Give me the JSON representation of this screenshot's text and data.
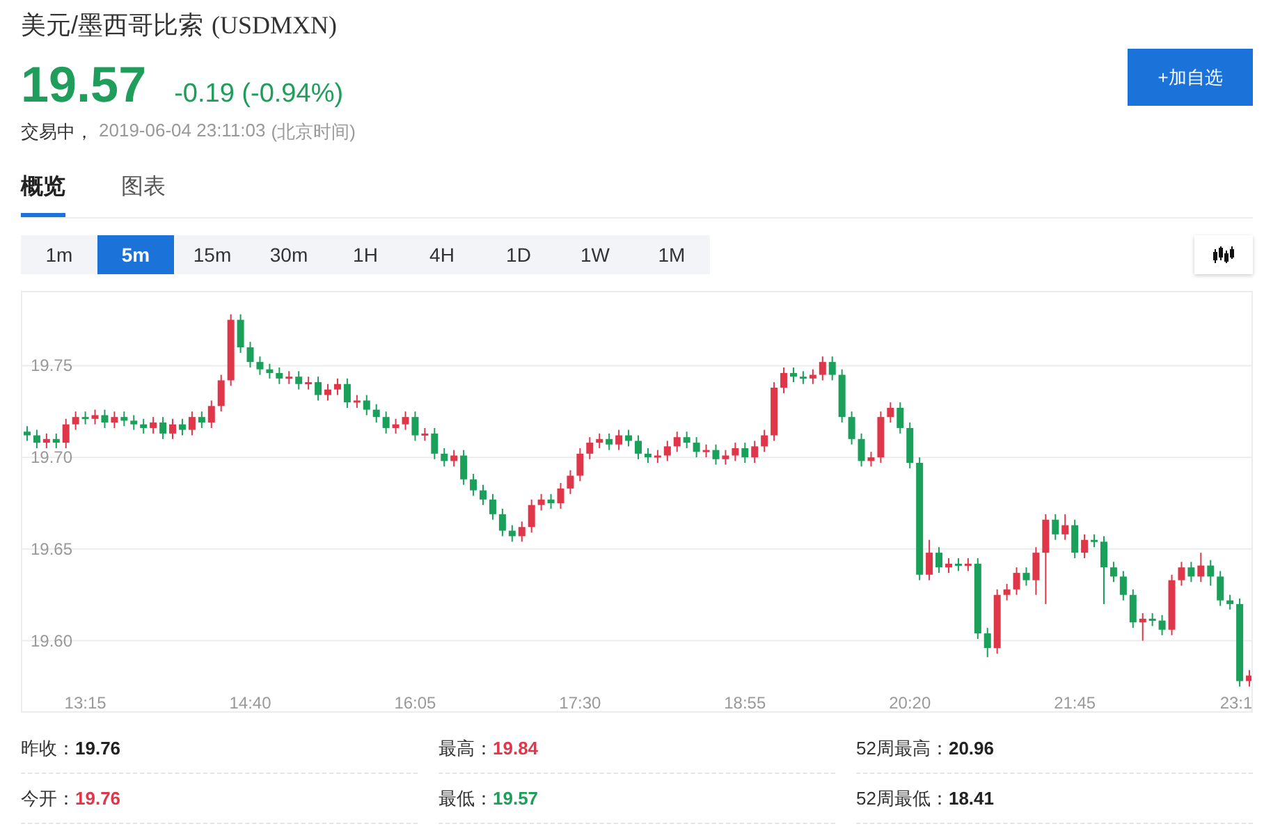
{
  "header": {
    "title": "美元/墨西哥比索",
    "code": "(USDMXN)",
    "price": "19.57",
    "change": "-0.19 (-0.94%)",
    "color": "#1e9e5a",
    "status": "交易中，",
    "time": "2019-06-04 23:11:03",
    "timezone": "(北京时间)",
    "watch_button": "+加自选"
  },
  "tabs": [
    {
      "label": "概览",
      "selected": true
    },
    {
      "label": "图表",
      "selected": false
    }
  ],
  "intervals": [
    {
      "label": "1m",
      "selected": false
    },
    {
      "label": "5m",
      "selected": true
    },
    {
      "label": "15m",
      "selected": false
    },
    {
      "label": "30m",
      "selected": false
    },
    {
      "label": "1H",
      "selected": false
    },
    {
      "label": "4H",
      "selected": false
    },
    {
      "label": "1D",
      "selected": false
    },
    {
      "label": "1W",
      "selected": false
    },
    {
      "label": "1M",
      "selected": false
    }
  ],
  "chart": {
    "chart_data": {
      "type": "candlestick",
      "categories": [
        null,
        null,
        null,
        null,
        null,
        null,
        "13:15",
        null,
        null,
        null,
        null,
        null,
        null,
        null,
        null,
        null,
        null,
        null,
        null,
        null,
        null,
        null,
        null,
        "14:40",
        null,
        null,
        null,
        null,
        null,
        null,
        null,
        null,
        null,
        null,
        null,
        null,
        null,
        null,
        null,
        null,
        "16:05",
        null,
        null,
        null,
        null,
        null,
        null,
        null,
        null,
        null,
        null,
        null,
        null,
        null,
        null,
        null,
        null,
        "17:30",
        null,
        null,
        null,
        null,
        null,
        null,
        null,
        null,
        null,
        null,
        null,
        null,
        null,
        null,
        null,
        null,
        "18:55",
        null,
        null,
        null,
        null,
        null,
        null,
        null,
        null,
        null,
        null,
        null,
        null,
        null,
        null,
        null,
        null,
        "20:20",
        null,
        null,
        null,
        null,
        null,
        null,
        null,
        null,
        null,
        null,
        null,
        null,
        null,
        null,
        null,
        null,
        "21:45",
        null,
        null,
        null,
        null,
        null,
        null,
        null,
        null,
        null,
        null,
        null,
        null,
        null,
        null,
        null,
        null,
        "23:1",
        null
      ],
      "ohlc": [
        [
          19.714,
          19.717,
          19.709,
          19.712
        ],
        [
          19.712,
          19.715,
          19.705,
          19.708
        ],
        [
          19.708,
          19.713,
          19.705,
          19.71
        ],
        [
          19.71,
          19.713,
          19.705,
          19.708
        ],
        [
          19.708,
          19.721,
          19.705,
          19.718
        ],
        [
          19.718,
          19.725,
          19.715,
          19.722
        ],
        [
          19.722,
          19.725,
          19.718,
          19.721
        ],
        [
          19.721,
          19.726,
          19.718,
          19.723
        ],
        [
          19.723,
          19.726,
          19.716,
          19.719
        ],
        [
          19.719,
          19.725,
          19.716,
          19.722
        ],
        [
          19.722,
          19.725,
          19.717,
          19.72
        ],
        [
          19.72,
          19.723,
          19.715,
          19.718
        ],
        [
          19.718,
          19.721,
          19.713,
          19.716
        ],
        [
          19.716,
          19.722,
          19.713,
          19.719
        ],
        [
          19.719,
          19.722,
          19.71,
          19.713
        ],
        [
          19.713,
          19.721,
          19.71,
          19.718
        ],
        [
          19.718,
          19.721,
          19.712,
          19.715
        ],
        [
          19.715,
          19.725,
          19.712,
          19.722
        ],
        [
          19.722,
          19.725,
          19.716,
          19.719
        ],
        [
          19.719,
          19.731,
          19.716,
          19.728
        ],
        [
          19.728,
          19.745,
          19.725,
          19.742
        ],
        [
          19.742,
          19.778,
          19.739,
          19.775
        ],
        [
          19.775,
          19.778,
          19.757,
          19.76
        ],
        [
          19.76,
          19.763,
          19.749,
          19.752
        ],
        [
          19.752,
          19.755,
          19.745,
          19.748
        ],
        [
          19.748,
          19.751,
          19.743,
          19.746
        ],
        [
          19.746,
          19.749,
          19.74,
          19.743
        ],
        [
          19.743,
          19.747,
          19.74,
          19.744
        ],
        [
          19.744,
          19.747,
          19.737,
          19.74
        ],
        [
          19.74,
          19.744,
          19.737,
          19.741
        ],
        [
          19.741,
          19.744,
          19.731,
          19.734
        ],
        [
          19.734,
          19.74,
          19.731,
          19.737
        ],
        [
          19.737,
          19.743,
          19.734,
          19.74
        ],
        [
          19.74,
          19.743,
          19.727,
          19.73
        ],
        [
          19.73,
          19.734,
          19.727,
          19.731
        ],
        [
          19.731,
          19.734,
          19.723,
          19.726
        ],
        [
          19.726,
          19.729,
          19.719,
          19.722
        ],
        [
          19.722,
          19.725,
          19.713,
          19.716
        ],
        [
          19.716,
          19.721,
          19.713,
          19.718
        ],
        [
          19.718,
          19.725,
          19.715,
          19.722
        ],
        [
          19.722,
          19.725,
          19.709,
          19.712
        ],
        [
          19.712,
          19.716,
          19.709,
          19.713
        ],
        [
          19.713,
          19.716,
          19.699,
          19.702
        ],
        [
          19.702,
          19.705,
          19.695,
          19.698
        ],
        [
          19.698,
          19.704,
          19.695,
          19.701
        ],
        [
          19.701,
          19.704,
          19.685,
          19.688
        ],
        [
          19.688,
          19.691,
          19.679,
          19.682
        ],
        [
          19.682,
          19.685,
          19.674,
          19.677
        ],
        [
          19.677,
          19.68,
          19.666,
          19.669
        ],
        [
          19.669,
          19.672,
          19.657,
          19.66
        ],
        [
          19.66,
          19.663,
          19.654,
          19.657
        ],
        [
          19.657,
          19.665,
          19.654,
          19.662
        ],
        [
          19.662,
          19.677,
          19.659,
          19.674
        ],
        [
          19.674,
          19.68,
          19.671,
          19.677
        ],
        [
          19.677,
          19.68,
          19.672,
          19.675
        ],
        [
          19.675,
          19.686,
          19.672,
          19.683
        ],
        [
          19.683,
          19.693,
          19.68,
          19.69
        ],
        [
          19.69,
          19.705,
          19.687,
          19.702
        ],
        [
          19.702,
          19.711,
          19.699,
          19.708
        ],
        [
          19.708,
          19.713,
          19.705,
          19.71
        ],
        [
          19.71,
          19.713,
          19.704,
          19.707
        ],
        [
          19.707,
          19.715,
          19.704,
          19.712
        ],
        [
          19.712,
          19.715,
          19.706,
          19.709
        ],
        [
          19.709,
          19.712,
          19.699,
          19.702
        ],
        [
          19.702,
          19.705,
          19.697,
          19.7
        ],
        [
          19.7,
          19.704,
          19.697,
          19.701
        ],
        [
          19.701,
          19.709,
          19.698,
          19.706
        ],
        [
          19.706,
          19.714,
          19.703,
          19.711
        ],
        [
          19.711,
          19.714,
          19.705,
          19.708
        ],
        [
          19.708,
          19.711,
          19.7,
          19.703
        ],
        [
          19.703,
          19.707,
          19.7,
          19.704
        ],
        [
          19.704,
          19.707,
          19.696,
          19.699
        ],
        [
          19.699,
          19.704,
          19.696,
          19.701
        ],
        [
          19.701,
          19.708,
          19.698,
          19.705
        ],
        [
          19.705,
          19.708,
          19.697,
          19.7
        ],
        [
          19.7,
          19.709,
          19.697,
          19.706
        ],
        [
          19.706,
          19.715,
          19.703,
          19.712
        ],
        [
          19.712,
          19.741,
          19.709,
          19.738
        ],
        [
          19.738,
          19.749,
          19.735,
          19.746
        ],
        [
          19.746,
          19.749,
          19.741,
          19.744
        ],
        [
          19.744,
          19.747,
          19.74,
          19.743
        ],
        [
          19.743,
          19.748,
          19.74,
          19.745
        ],
        [
          19.745,
          19.755,
          19.742,
          19.752
        ],
        [
          19.752,
          19.755,
          19.742,
          19.745
        ],
        [
          19.745,
          19.748,
          19.719,
          19.722
        ],
        [
          19.722,
          19.725,
          19.707,
          19.71
        ],
        [
          19.71,
          19.713,
          19.695,
          19.698
        ],
        [
          19.698,
          19.703,
          19.695,
          19.7
        ],
        [
          19.7,
          19.725,
          19.697,
          19.722
        ],
        [
          19.722,
          19.73,
          19.719,
          19.727
        ],
        [
          19.727,
          19.73,
          19.713,
          19.716
        ],
        [
          19.716,
          19.719,
          19.694,
          19.697
        ],
        [
          19.697,
          19.7,
          19.633,
          19.636
        ],
        [
          19.636,
          19.655,
          19.633,
          19.648
        ],
        [
          19.648,
          19.651,
          19.637,
          19.64
        ],
        [
          19.64,
          19.645,
          19.637,
          19.642
        ],
        [
          19.642,
          19.645,
          19.638,
          19.641
        ],
        [
          19.641,
          19.645,
          19.638,
          19.642
        ],
        [
          19.642,
          19.645,
          19.601,
          19.604
        ],
        [
          19.604,
          19.607,
          19.591,
          19.596
        ],
        [
          19.596,
          19.628,
          19.593,
          19.625
        ],
        [
          19.625,
          19.631,
          19.622,
          19.628
        ],
        [
          19.628,
          19.64,
          19.625,
          19.637
        ],
        [
          19.637,
          19.64,
          19.63,
          19.633
        ],
        [
          19.633,
          19.651,
          19.625,
          19.648
        ],
        [
          19.648,
          19.669,
          19.62,
          19.666
        ],
        [
          19.666,
          19.669,
          19.655,
          19.658
        ],
        [
          19.658,
          19.669,
          19.655,
          19.663
        ],
        [
          19.663,
          19.666,
          19.645,
          19.648
        ],
        [
          19.648,
          19.658,
          19.645,
          19.655
        ],
        [
          19.655,
          19.658,
          19.651,
          19.654
        ],
        [
          19.654,
          19.657,
          19.62,
          19.64
        ],
        [
          19.64,
          19.643,
          19.632,
          19.635
        ],
        [
          19.635,
          19.638,
          19.622,
          19.625
        ],
        [
          19.625,
          19.628,
          19.607,
          19.61
        ],
        [
          19.61,
          19.615,
          19.6,
          19.612
        ],
        [
          19.612,
          19.615,
          19.608,
          19.611
        ],
        [
          19.611,
          19.614,
          19.603,
          19.606
        ],
        [
          19.606,
          19.636,
          19.603,
          19.633
        ],
        [
          19.633,
          19.643,
          19.63,
          19.64
        ],
        [
          19.64,
          19.643,
          19.632,
          19.635
        ],
        [
          19.635,
          19.648,
          19.632,
          19.641
        ],
        [
          19.641,
          19.644,
          19.63,
          19.635
        ],
        [
          19.635,
          19.638,
          19.619,
          19.622
        ],
        [
          19.622,
          19.625,
          19.617,
          19.62
        ],
        [
          19.62,
          19.623,
          19.575,
          19.578
        ],
        [
          19.578,
          19.584,
          19.575,
          19.581
        ]
      ],
      "grid": true,
      "ylim": [
        19.56,
        19.79
      ],
      "yticks": [
        {
          "value": 19.75,
          "label": "19.75"
        },
        {
          "value": 19.7,
          "label": "19.70"
        },
        {
          "value": 19.65,
          "label": "19.65"
        },
        {
          "value": 19.6,
          "label": "19.60"
        }
      ]
    }
  },
  "stats": [
    {
      "label": "昨收：",
      "value": "19.76",
      "color": "#222222"
    },
    {
      "label": "最高：",
      "value": "19.84",
      "color": "#e0364a"
    },
    {
      "label": "52周最高：",
      "value": "20.96",
      "color": "#222222"
    },
    {
      "label": "今开：",
      "value": "19.76",
      "color": "#e0364a"
    },
    {
      "label": "最低：",
      "value": "19.57",
      "color": "#1e9e5a"
    },
    {
      "label": "52周最低：",
      "value": "18.41",
      "color": "#222222"
    }
  ]
}
